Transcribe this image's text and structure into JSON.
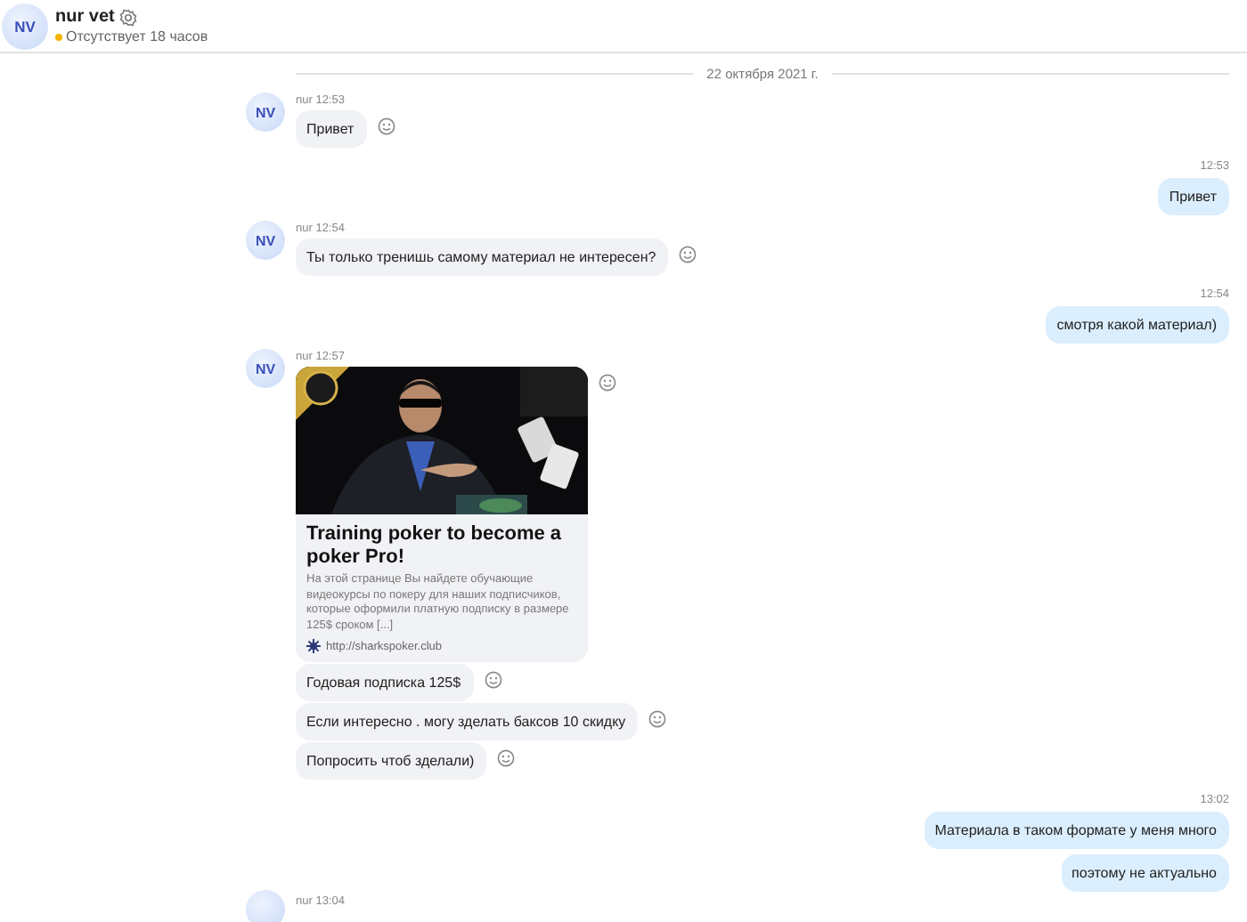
{
  "contact": {
    "initials": "NV",
    "name": "nur vet",
    "status": "Отсутствует 18 часов",
    "away": true
  },
  "date_divider": "22 октября 2021 г.",
  "messages": [
    {
      "kind": "incoming",
      "initials": "NV",
      "author": "nur",
      "time": "12:53",
      "bubbles": [
        {
          "kind": "text",
          "text": "Привет"
        }
      ]
    },
    {
      "kind": "outgoing",
      "time": "12:53",
      "bubbles": [
        {
          "kind": "text",
          "text": "Привет"
        }
      ]
    },
    {
      "kind": "incoming",
      "initials": "NV",
      "author": "nur",
      "time": "12:54",
      "bubbles": [
        {
          "kind": "text",
          "text": "Ты только тренишь самому материал не интересен?"
        }
      ]
    },
    {
      "kind": "outgoing",
      "time": "12:54",
      "bubbles": [
        {
          "kind": "text",
          "text": "смотря какой материал)"
        }
      ]
    },
    {
      "kind": "incoming",
      "initials": "NV",
      "author": "nur",
      "time": "12:57",
      "bubbles": [
        {
          "kind": "link_preview",
          "title": "Training poker to become a poker Pro!",
          "description": "На этой странице Вы найдете обучающие видеокурсы по покеру для наших подписчиков, которые оформили платную подписку в размере  125$ сроком [...]",
          "url": "http://sharkspoker.club"
        },
        {
          "kind": "text",
          "text": "Годовая подписка 125$"
        },
        {
          "kind": "text",
          "text": "Если интересно . могу зделать баксов 10 скидку"
        },
        {
          "kind": "text",
          "text": "Попросить чтоб зделали)"
        }
      ]
    },
    {
      "kind": "outgoing",
      "time": "13:02",
      "bubbles": [
        {
          "kind": "text",
          "text": "Материала в таком формате у меня много"
        },
        {
          "kind": "text",
          "text": "поэтому не актуально"
        }
      ]
    },
    {
      "kind": "incoming",
      "author": "nur",
      "time": "13:04"
    }
  ]
}
